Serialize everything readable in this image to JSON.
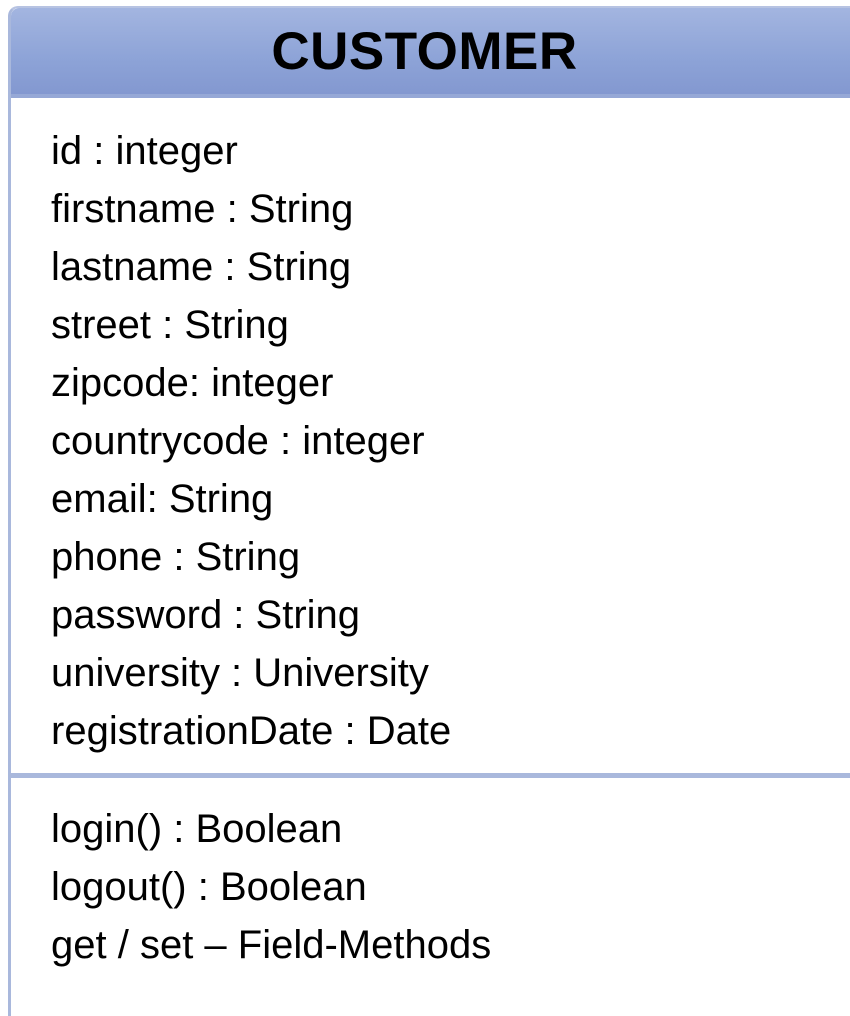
{
  "class": {
    "name": "CUSTOMER",
    "attributes": [
      "id : integer",
      "firstname : String",
      "lastname : String",
      "street : String",
      "zipcode: integer",
      "countrycode : integer",
      "email: String",
      "phone : String",
      "password : String",
      "university : University",
      "registrationDate : Date"
    ],
    "operations": [
      "login() : Boolean",
      "logout() : Boolean",
      "get / set – Field-Methods"
    ]
  },
  "colors": {
    "header_fill": "#8da3d7",
    "border": "#a9b8dc",
    "text": "#000000"
  }
}
